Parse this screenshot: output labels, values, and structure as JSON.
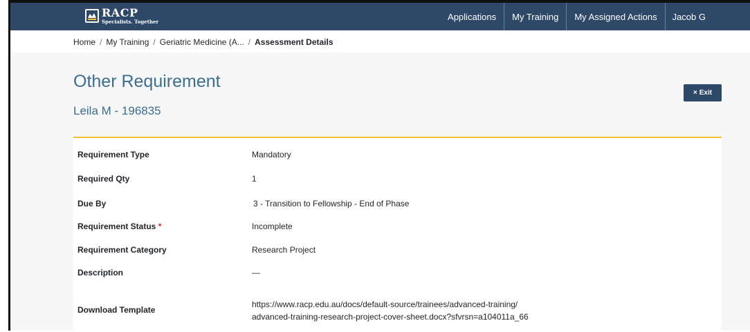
{
  "brand": {
    "name": "RACP",
    "tagline": "Specialists. Together"
  },
  "nav": {
    "items": [
      "Applications",
      "My Training",
      "My Assigned Actions"
    ],
    "user": "Jacob G"
  },
  "breadcrumb": {
    "home": "Home",
    "separator": "/",
    "my_training": "My Training",
    "program": "Geriatric Medicine (A...",
    "current": "Assessment Details"
  },
  "page": {
    "title": "Other Requirement",
    "subtitle": "Leila M - 196835",
    "exit_icon": "×",
    "exit_label": "Exit"
  },
  "details": {
    "requirement_type_label": "Requirement Type",
    "requirement_type": "Mandatory",
    "required_qty_label": "Required Qty",
    "required_qty": "1",
    "due_by_label": "Due By",
    "due_by": "3 - Transition to Fellowship - End of Phase",
    "status_label": "Requirement Status",
    "status_required_marker": "*",
    "status": "Incomplete",
    "category_label": "Requirement Category",
    "category": "Research Project",
    "description_label": "Description",
    "description": "—",
    "template_label": "Download Template",
    "template_url": "https://www.racp.edu.au/docs/default-source/trainees/advanced-training/advanced-training-research-project-cover-sheet.docx?sfvrsn=a104011a_66"
  },
  "colors": {
    "navbar": "#2e4868",
    "title": "#3b6e8f",
    "accent": "#f5c12e",
    "link": "#1f6fc5",
    "required": "#d9232e"
  }
}
